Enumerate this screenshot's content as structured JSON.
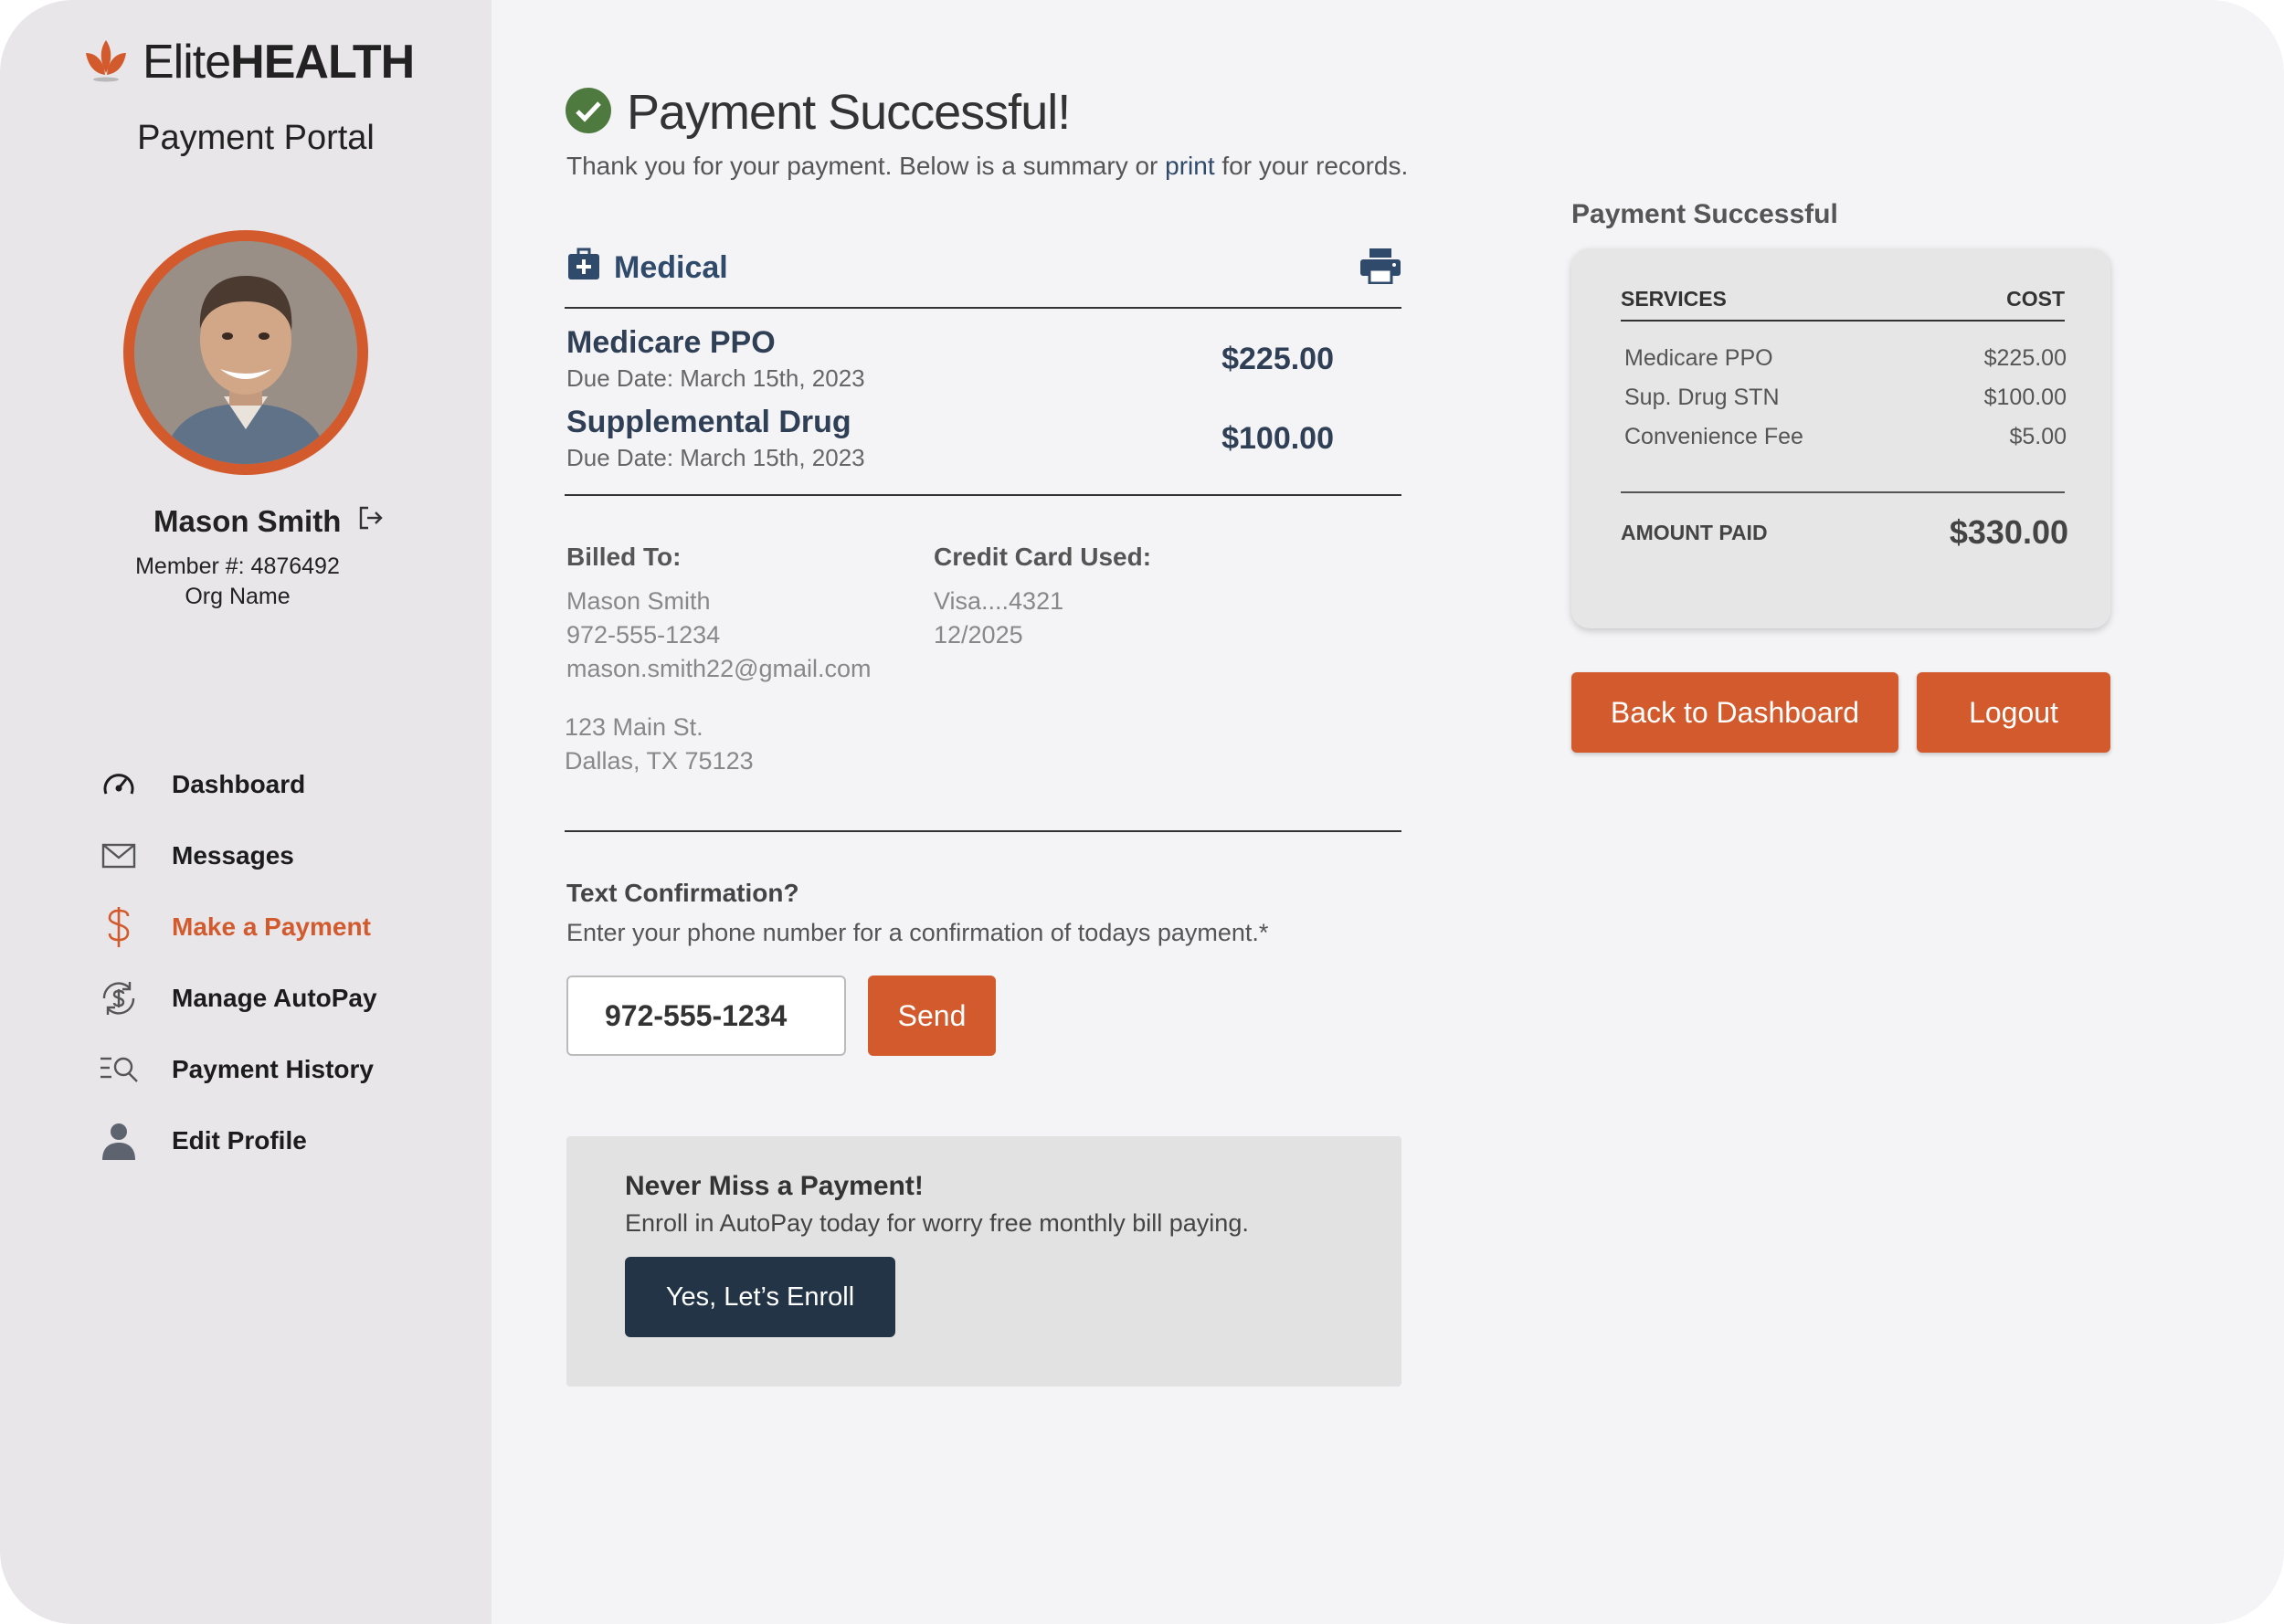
{
  "brand": {
    "name_light": "Elite",
    "name_bold": "HEALTH",
    "portal_label": "Payment Portal",
    "accent_color": "#d35a2c",
    "navy_color": "#2f4a6b"
  },
  "user": {
    "name": "Mason Smith",
    "member_number": "Member #: 4876492",
    "org": "Org Name"
  },
  "nav": [
    {
      "label": "Dashboard",
      "icon": "speedometer-icon"
    },
    {
      "label": "Messages",
      "icon": "envelope-icon"
    },
    {
      "label": "Make a Payment",
      "icon": "dollar-icon",
      "active": true
    },
    {
      "label": "Manage AutoPay",
      "icon": "autopay-cycle-icon"
    },
    {
      "label": "Payment History",
      "icon": "history-search-icon"
    },
    {
      "label": "Edit Profile",
      "icon": "person-icon"
    }
  ],
  "main": {
    "title": "Payment Successful!",
    "subtitle_before": "Thank you for your payment. Below is a summary or ",
    "subtitle_link": "print",
    "subtitle_after": " for your records.",
    "section_label": "Medical",
    "items": [
      {
        "name": "Medicare PPO",
        "due": "Due Date: March 15th, 2023",
        "amount": "$225.00"
      },
      {
        "name": "Supplemental Drug",
        "due": "Due Date: March 15th, 2023",
        "amount": "$100.00"
      }
    ],
    "billed_to": {
      "label": "Billed To:",
      "name": "Mason Smith",
      "phone": "972-555-1234",
      "email": "mason.smith22@gmail.com",
      "address1": "123 Main St.",
      "address2": "Dallas, TX 75123"
    },
    "card_used": {
      "label": "Credit Card Used:",
      "number": "Visa....4321",
      "expiry": "12/2025"
    },
    "text_confirmation": {
      "title": "Text Confirmation?",
      "description": "Enter your phone number for a confirmation of todays payment.*",
      "phone_value": "972-555-1234",
      "send_label": "Send"
    },
    "autopay": {
      "title": "Never Miss a Payment!",
      "description": "Enroll in AutoPay today for worry free monthly bill paying.",
      "button_label": "Yes, Let’s Enroll"
    }
  },
  "summary": {
    "title": "Payment Successful",
    "col_services": "SERVICES",
    "col_cost": "COST",
    "rows": [
      {
        "service": "Medicare PPO",
        "cost": "$225.00"
      },
      {
        "service": "Sup. Drug STN",
        "cost": "$100.00"
      },
      {
        "service": "Convenience Fee",
        "cost": "$5.00"
      }
    ],
    "total_label": "AMOUNT PAID",
    "total_value": "$330.00",
    "back_button": "Back to Dashboard",
    "logout_button": "Logout"
  }
}
